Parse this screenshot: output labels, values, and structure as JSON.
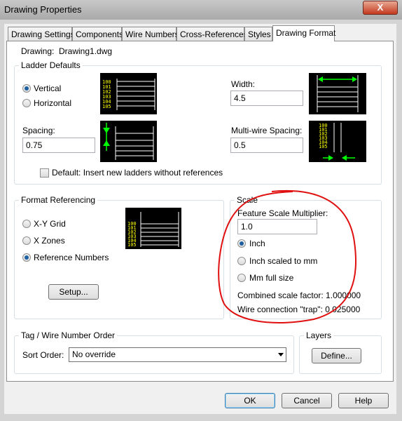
{
  "window": {
    "title": "Drawing Properties",
    "close_glyph": "X"
  },
  "tabs": [
    {
      "label": "Drawing Settings",
      "active": false
    },
    {
      "label": "Components",
      "active": false
    },
    {
      "label": "Wire Numbers",
      "active": false
    },
    {
      "label": "Cross-References",
      "active": false
    },
    {
      "label": "Styles",
      "active": false
    },
    {
      "label": "Drawing Format",
      "active": true
    }
  ],
  "drawing": {
    "label": "Drawing:",
    "value": "Drawing1.dwg"
  },
  "ladder_defaults": {
    "title": "Ladder Defaults",
    "orientation": [
      {
        "label": "Vertical",
        "selected": true
      },
      {
        "label": "Horizontal",
        "selected": false
      }
    ],
    "width_label": "Width:",
    "width_value": "4.5",
    "spacing_label": "Spacing:",
    "spacing_value": "0.75",
    "multiwire_label": "Multi-wire Spacing:",
    "multiwire_value": "0.5",
    "default_checkbox_label": "Default: Insert new ladders without references",
    "default_checked": false,
    "preview_numbers": [
      "100",
      "101",
      "102",
      "103",
      "104",
      "105"
    ]
  },
  "format_referencing": {
    "title": "Format Referencing",
    "options": [
      {
        "label": "X-Y Grid",
        "selected": false
      },
      {
        "label": "X Zones",
        "selected": false
      },
      {
        "label": "Reference Numbers",
        "selected": true
      }
    ],
    "setup_label": "Setup...",
    "preview_numbers": [
      "100",
      "101",
      "102",
      "103",
      "104",
      "105"
    ]
  },
  "scale": {
    "title": "Scale",
    "multiplier_label": "Feature Scale Multiplier:",
    "multiplier_value": "1.0",
    "options": [
      {
        "label": "Inch",
        "selected": true
      },
      {
        "label": "Inch scaled to mm",
        "selected": false
      },
      {
        "label": "Mm full size",
        "selected": false
      }
    ],
    "combined_factor": "Combined scale factor: 1.000000",
    "wire_trap": "Wire connection \"trap\": 0.025000"
  },
  "tag_order": {
    "title": "Tag / Wire Number Order",
    "sort_label": "Sort Order:",
    "sort_value": "No override"
  },
  "layers": {
    "title": "Layers",
    "define_label": "Define..."
  },
  "footer": {
    "ok_label": "OK",
    "cancel_label": "Cancel",
    "help_label": "Help"
  },
  "colors": {
    "annotation_circle": "#e01010",
    "preview_text": "#ffff00",
    "preview_arrow": "#00ff00"
  }
}
